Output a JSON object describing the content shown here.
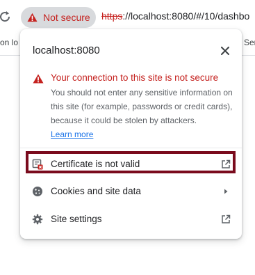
{
  "toolbar": {
    "security_chip_label": "Not secure",
    "url_scheme": "https",
    "url_rest": "://localhost:8080/#/10/dashbo"
  },
  "bookmarks": {
    "left_fragment": "on lo",
    "right_fragment": "Ser"
  },
  "popup": {
    "site": "localhost:8080",
    "warning_heading": "Your connection to this site is not secure",
    "warning_body": "You should not enter any sensitive information on this site (for example, passwords or credit cards), because it could be stolen by attackers.",
    "learn_more": "Learn more",
    "rows": [
      {
        "label": "Certificate is not valid",
        "icon": "certificate-error-icon",
        "trail": "open-external-icon"
      },
      {
        "label": "Cookies and site data",
        "icon": "cookie-icon",
        "trail": "chevron-right-icon"
      },
      {
        "label": "Site settings",
        "icon": "gear-icon",
        "trail": "open-external-icon"
      }
    ]
  },
  "colors": {
    "danger": "#c5221f",
    "link": "#1a73e8",
    "highlight_border": "#7a0b1d",
    "chip_bg": "#d8dadd"
  }
}
